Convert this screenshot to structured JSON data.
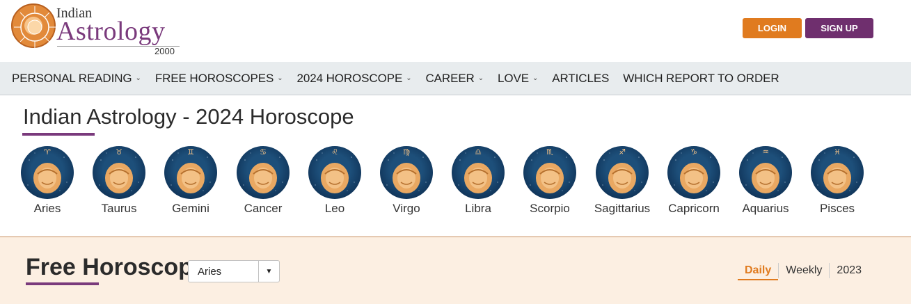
{
  "logo": {
    "line1": "Indian",
    "line2": "Astrology",
    "year": "2000"
  },
  "header": {
    "login_label": "LOGIN",
    "signup_label": "SIGN UP"
  },
  "nav": {
    "items": [
      {
        "label": "PERSONAL READING",
        "dropdown": "⌄"
      },
      {
        "label": "FREE HOROSCOPES",
        "dropdown": "⌄"
      },
      {
        "label": "2024 HOROSCOPE",
        "dropdown": "⌄"
      },
      {
        "label": "CAREER",
        "dropdown": "⌄"
      },
      {
        "label": "LOVE",
        "dropdown": "⌄"
      },
      {
        "label": "ARTICLES"
      },
      {
        "label": "WHICH REPORT TO ORDER"
      }
    ]
  },
  "main": {
    "title": "Indian Astrology - 2024 Horoscope"
  },
  "signs": [
    {
      "name": "Aries",
      "symbol": "♈"
    },
    {
      "name": "Taurus",
      "symbol": "♉"
    },
    {
      "name": "Gemini",
      "symbol": "♊"
    },
    {
      "name": "Cancer",
      "symbol": "♋"
    },
    {
      "name": "Leo",
      "symbol": "♌"
    },
    {
      "name": "Virgo",
      "symbol": "♍"
    },
    {
      "name": "Libra",
      "symbol": "♎"
    },
    {
      "name": "Scorpio",
      "symbol": "♏"
    },
    {
      "name": "Sagittarius",
      "symbol": "♐"
    },
    {
      "name": "Capricorn",
      "symbol": "♑"
    },
    {
      "name": "Aquarius",
      "symbol": "♒"
    },
    {
      "name": "Pisces",
      "symbol": "♓"
    }
  ],
  "free_horoscope": {
    "title": "Free Horoscope",
    "select_value": "Aries",
    "tabs": [
      {
        "label": "Daily",
        "active": true
      },
      {
        "label": "Weekly",
        "active": false
      },
      {
        "label": "2023",
        "active": false
      }
    ]
  },
  "colors": {
    "accent_orange": "#e07b1f",
    "brand_purple": "#6f2f6e",
    "nav_bg": "#e8ecee",
    "section_bg": "#fcefe2",
    "sign_circle": "#0e3054"
  }
}
